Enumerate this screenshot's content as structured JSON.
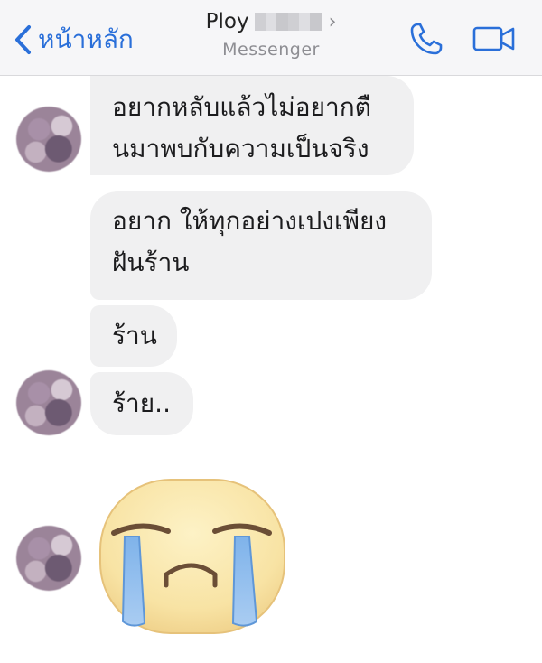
{
  "header": {
    "back_label": "หน้าหลัก",
    "contact_name": "Ploy",
    "subtitle": "Messenger"
  },
  "messages": [
    {
      "text": "อยากหลับแล้วไม่อยากตื\nนมาพบกับความเป็นจริง"
    },
    {
      "text": "อยาก ให้ทุกอย่างเปงเพียง\nฝันร้าน"
    },
    {
      "text": "ร้าน"
    },
    {
      "text": "ร้าย.."
    }
  ],
  "sticker": {
    "icon": "crying-face-icon"
  },
  "colors": {
    "accent": "#2a6fd9",
    "bubble_bg": "#f0f0f1",
    "header_bg": "#f6f6f8"
  }
}
